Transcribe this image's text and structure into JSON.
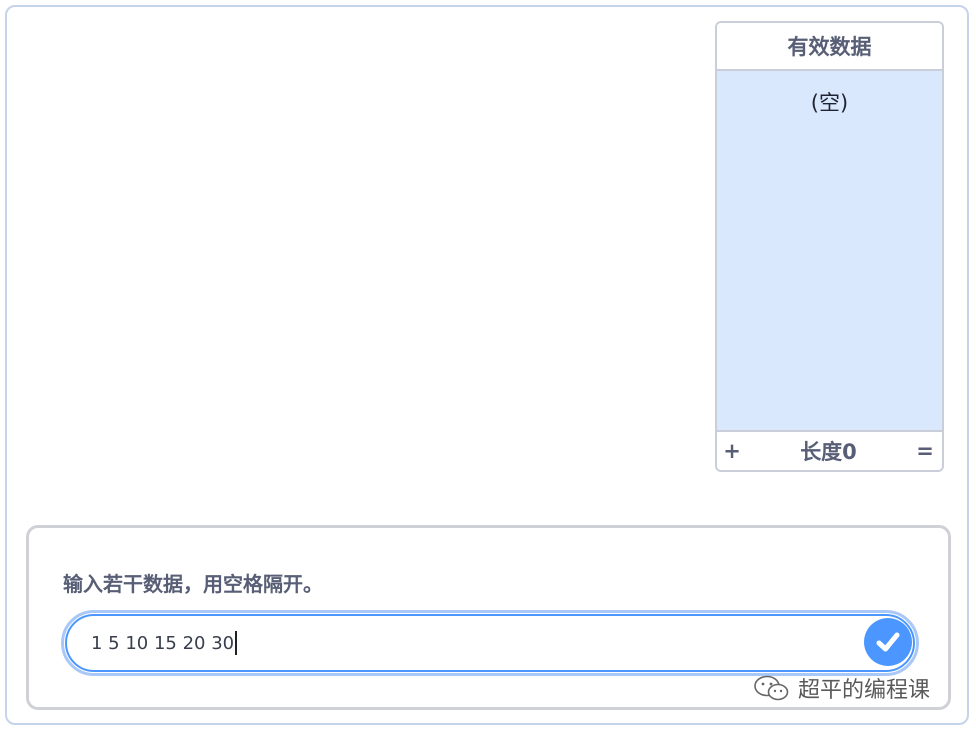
{
  "list_monitor": {
    "title": "有效数据",
    "empty_text": "(空)",
    "add_label": "+",
    "length_text": "长度0",
    "resize_label": "="
  },
  "ask": {
    "question": "输入若干数据，用空格隔开。",
    "input_value": "1 5 10 15 20 30"
  },
  "watermark": {
    "text": "超平的编程课",
    "icon": "wechat-icon"
  },
  "colors": {
    "accent": "#4c97ff",
    "list_bg": "#dae8fd",
    "label": "#575e75"
  }
}
